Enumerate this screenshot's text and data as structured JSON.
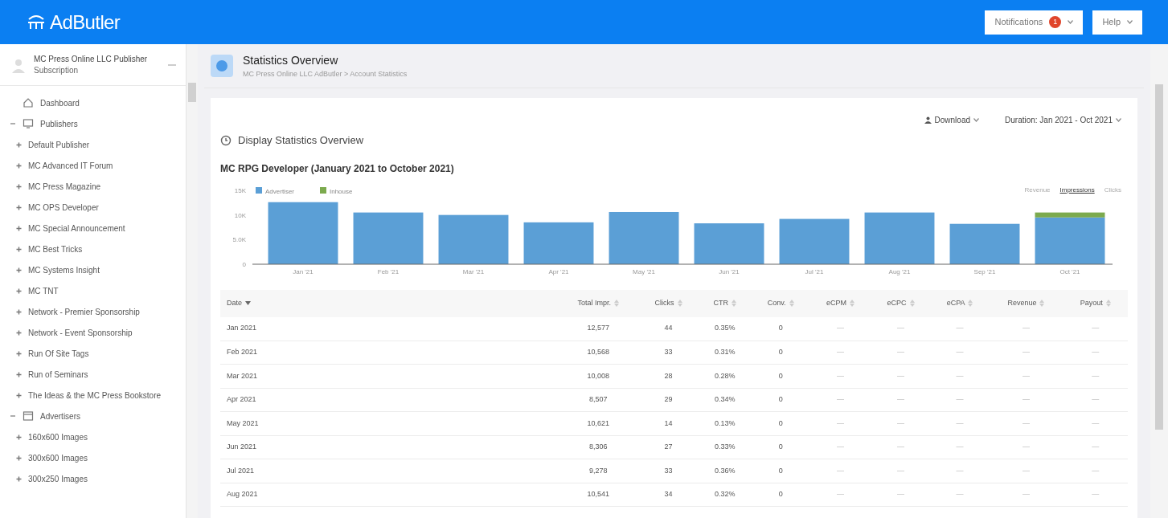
{
  "header": {
    "logo": "AdButler",
    "account_menu": {
      "label": "Notifications",
      "badge": "1"
    },
    "help_menu": {
      "label": "Help"
    }
  },
  "sidebar": {
    "account": {
      "name": "MC Press Online LLC Publisher",
      "subtitle": "Subscription"
    },
    "items": [
      {
        "label": "Dashboard",
        "kind": "link"
      },
      {
        "label": "Publishers",
        "kind": "group",
        "expanded": true,
        "children": [
          {
            "label": "Default Publisher"
          },
          {
            "label": "MC Advanced IT Forum"
          },
          {
            "label": "MC Press Magazine"
          },
          {
            "label": "MC OPS Developer"
          },
          {
            "label": "MC Special Announcement"
          },
          {
            "label": "MC Best Tricks"
          },
          {
            "label": "MC Systems Insight"
          },
          {
            "label": "MC TNT"
          },
          {
            "label": "Network - Premier Sponsorship"
          },
          {
            "label": "Network - Event Sponsorship"
          },
          {
            "label": "Run Of Site Tags"
          },
          {
            "label": "Run of Seminars"
          },
          {
            "label": "The Ideas & the MC Press Bookstore"
          }
        ]
      },
      {
        "label": "Advertisers",
        "kind": "group",
        "expanded": true,
        "children": [
          {
            "label": "160x600 Images"
          },
          {
            "label": "300x600 Images"
          },
          {
            "label": "300x250 Images"
          }
        ]
      }
    ]
  },
  "page": {
    "title": "Statistics Overview",
    "breadcrumb": "MC Press Online LLC AdButler > Account Statistics"
  },
  "card": {
    "title": "Display Statistics Overview",
    "download": "Download",
    "duration": "Duration: Jan 2021 - Oct 2021",
    "chart_title": "MC RPG Developer (January 2021 to October 2021)",
    "metric_tabs": [
      {
        "label": "Revenue",
        "selected": false
      },
      {
        "label": "Impressions",
        "selected": true
      },
      {
        "label": "Clicks",
        "selected": false
      }
    ],
    "chart_data": {
      "type": "bar",
      "stacked": true,
      "legend": "top-left",
      "categories": [
        "Jan '21",
        "Feb '21",
        "Mar '21",
        "Apr '21",
        "May '21",
        "Jun '21",
        "Jul '21",
        "Aug '21",
        "Sep '21",
        "Oct '21"
      ],
      "series": [
        {
          "name": "Advertiser",
          "color": "#5b9fd6",
          "values": [
            12600,
            10500,
            10000,
            8500,
            10600,
            8300,
            9200,
            10500,
            8200,
            9500
          ]
        },
        {
          "name": "Inhouse",
          "color": "#7caa4e",
          "values": [
            0,
            0,
            0,
            0,
            0,
            0,
            0,
            0,
            0,
            1000
          ]
        }
      ],
      "ylim": [
        0,
        15000
      ],
      "yticks": [
        {
          "value": 0,
          "label": "0"
        },
        {
          "value": 5000,
          "label": "5.0K"
        },
        {
          "value": 10000,
          "label": "10K"
        },
        {
          "value": 15000,
          "label": "15K"
        }
      ]
    },
    "table": {
      "columns": [
        "Date",
        "Total Impr.",
        "Clicks",
        "CTR",
        "Conv.",
        "eCPM",
        "eCPC",
        "eCPA",
        "Revenue",
        "Payout"
      ],
      "rows": [
        [
          "Jan 2021",
          "12,577",
          "44",
          "0.35%",
          "0",
          "—",
          "—",
          "—",
          "—",
          "—"
        ],
        [
          "Feb 2021",
          "10,568",
          "33",
          "0.31%",
          "0",
          "—",
          "—",
          "—",
          "—",
          "—"
        ],
        [
          "Mar 2021",
          "10,008",
          "28",
          "0.28%",
          "0",
          "—",
          "—",
          "—",
          "—",
          "—"
        ],
        [
          "Apr 2021",
          "8,507",
          "29",
          "0.34%",
          "0",
          "—",
          "—",
          "—",
          "—",
          "—"
        ],
        [
          "May 2021",
          "10,621",
          "14",
          "0.13%",
          "0",
          "—",
          "—",
          "—",
          "—",
          "—"
        ],
        [
          "Jun 2021",
          "8,306",
          "27",
          "0.33%",
          "0",
          "—",
          "—",
          "—",
          "—",
          "—"
        ],
        [
          "Jul 2021",
          "9,278",
          "33",
          "0.36%",
          "0",
          "—",
          "—",
          "—",
          "—",
          "—"
        ],
        [
          "Aug 2021",
          "10,541",
          "34",
          "0.32%",
          "0",
          "—",
          "—",
          "—",
          "—",
          "—"
        ]
      ]
    }
  }
}
